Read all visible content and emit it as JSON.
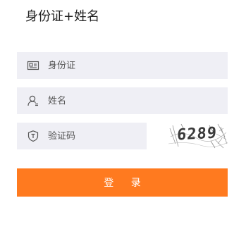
{
  "form": {
    "title": "身份证+姓名",
    "fields": {
      "id_card": {
        "icon": "id-card-icon",
        "placeholder": "身份证",
        "value": ""
      },
      "name": {
        "icon": "user-icon",
        "placeholder": "姓名",
        "value": ""
      },
      "captcha": {
        "icon": "shield-icon",
        "placeholder": "验证码",
        "value": ""
      }
    },
    "captcha_image": {
      "code": "6289"
    },
    "login_button_label": "登 录"
  },
  "colors": {
    "accent": "#ff7a1f",
    "field_background": "#efeff5",
    "text": "#222222"
  }
}
